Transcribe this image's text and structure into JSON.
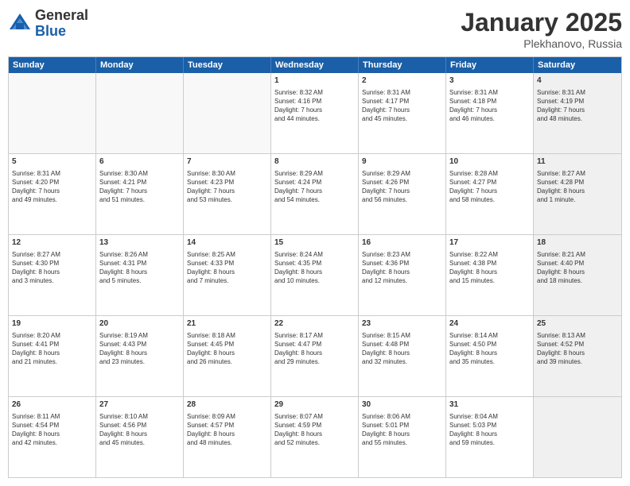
{
  "header": {
    "logo_general": "General",
    "logo_blue": "Blue",
    "title": "January 2025",
    "location": "Plekhanovo, Russia"
  },
  "weekdays": [
    "Sunday",
    "Monday",
    "Tuesday",
    "Wednesday",
    "Thursday",
    "Friday",
    "Saturday"
  ],
  "rows": [
    [
      {
        "day": "",
        "text": "",
        "empty": true
      },
      {
        "day": "",
        "text": "",
        "empty": true
      },
      {
        "day": "",
        "text": "",
        "empty": true
      },
      {
        "day": "1",
        "text": "Sunrise: 8:32 AM\nSunset: 4:16 PM\nDaylight: 7 hours\nand 44 minutes."
      },
      {
        "day": "2",
        "text": "Sunrise: 8:31 AM\nSunset: 4:17 PM\nDaylight: 7 hours\nand 45 minutes."
      },
      {
        "day": "3",
        "text": "Sunrise: 8:31 AM\nSunset: 4:18 PM\nDaylight: 7 hours\nand 46 minutes."
      },
      {
        "day": "4",
        "text": "Sunrise: 8:31 AM\nSunset: 4:19 PM\nDaylight: 7 hours\nand 48 minutes.",
        "shaded": true
      }
    ],
    [
      {
        "day": "5",
        "text": "Sunrise: 8:31 AM\nSunset: 4:20 PM\nDaylight: 7 hours\nand 49 minutes."
      },
      {
        "day": "6",
        "text": "Sunrise: 8:30 AM\nSunset: 4:21 PM\nDaylight: 7 hours\nand 51 minutes."
      },
      {
        "day": "7",
        "text": "Sunrise: 8:30 AM\nSunset: 4:23 PM\nDaylight: 7 hours\nand 53 minutes."
      },
      {
        "day": "8",
        "text": "Sunrise: 8:29 AM\nSunset: 4:24 PM\nDaylight: 7 hours\nand 54 minutes."
      },
      {
        "day": "9",
        "text": "Sunrise: 8:29 AM\nSunset: 4:26 PM\nDaylight: 7 hours\nand 56 minutes."
      },
      {
        "day": "10",
        "text": "Sunrise: 8:28 AM\nSunset: 4:27 PM\nDaylight: 7 hours\nand 58 minutes."
      },
      {
        "day": "11",
        "text": "Sunrise: 8:27 AM\nSunset: 4:28 PM\nDaylight: 8 hours\nand 1 minute.",
        "shaded": true
      }
    ],
    [
      {
        "day": "12",
        "text": "Sunrise: 8:27 AM\nSunset: 4:30 PM\nDaylight: 8 hours\nand 3 minutes."
      },
      {
        "day": "13",
        "text": "Sunrise: 8:26 AM\nSunset: 4:31 PM\nDaylight: 8 hours\nand 5 minutes."
      },
      {
        "day": "14",
        "text": "Sunrise: 8:25 AM\nSunset: 4:33 PM\nDaylight: 8 hours\nand 7 minutes."
      },
      {
        "day": "15",
        "text": "Sunrise: 8:24 AM\nSunset: 4:35 PM\nDaylight: 8 hours\nand 10 minutes."
      },
      {
        "day": "16",
        "text": "Sunrise: 8:23 AM\nSunset: 4:36 PM\nDaylight: 8 hours\nand 12 minutes."
      },
      {
        "day": "17",
        "text": "Sunrise: 8:22 AM\nSunset: 4:38 PM\nDaylight: 8 hours\nand 15 minutes."
      },
      {
        "day": "18",
        "text": "Sunrise: 8:21 AM\nSunset: 4:40 PM\nDaylight: 8 hours\nand 18 minutes.",
        "shaded": true
      }
    ],
    [
      {
        "day": "19",
        "text": "Sunrise: 8:20 AM\nSunset: 4:41 PM\nDaylight: 8 hours\nand 21 minutes."
      },
      {
        "day": "20",
        "text": "Sunrise: 8:19 AM\nSunset: 4:43 PM\nDaylight: 8 hours\nand 23 minutes."
      },
      {
        "day": "21",
        "text": "Sunrise: 8:18 AM\nSunset: 4:45 PM\nDaylight: 8 hours\nand 26 minutes."
      },
      {
        "day": "22",
        "text": "Sunrise: 8:17 AM\nSunset: 4:47 PM\nDaylight: 8 hours\nand 29 minutes."
      },
      {
        "day": "23",
        "text": "Sunrise: 8:15 AM\nSunset: 4:48 PM\nDaylight: 8 hours\nand 32 minutes."
      },
      {
        "day": "24",
        "text": "Sunrise: 8:14 AM\nSunset: 4:50 PM\nDaylight: 8 hours\nand 35 minutes."
      },
      {
        "day": "25",
        "text": "Sunrise: 8:13 AM\nSunset: 4:52 PM\nDaylight: 8 hours\nand 39 minutes.",
        "shaded": true
      }
    ],
    [
      {
        "day": "26",
        "text": "Sunrise: 8:11 AM\nSunset: 4:54 PM\nDaylight: 8 hours\nand 42 minutes."
      },
      {
        "day": "27",
        "text": "Sunrise: 8:10 AM\nSunset: 4:56 PM\nDaylight: 8 hours\nand 45 minutes."
      },
      {
        "day": "28",
        "text": "Sunrise: 8:09 AM\nSunset: 4:57 PM\nDaylight: 8 hours\nand 48 minutes."
      },
      {
        "day": "29",
        "text": "Sunrise: 8:07 AM\nSunset: 4:59 PM\nDaylight: 8 hours\nand 52 minutes."
      },
      {
        "day": "30",
        "text": "Sunrise: 8:06 AM\nSunset: 5:01 PM\nDaylight: 8 hours\nand 55 minutes."
      },
      {
        "day": "31",
        "text": "Sunrise: 8:04 AM\nSunset: 5:03 PM\nDaylight: 8 hours\nand 59 minutes."
      },
      {
        "day": "",
        "text": "",
        "empty": true,
        "shaded": true
      }
    ]
  ]
}
